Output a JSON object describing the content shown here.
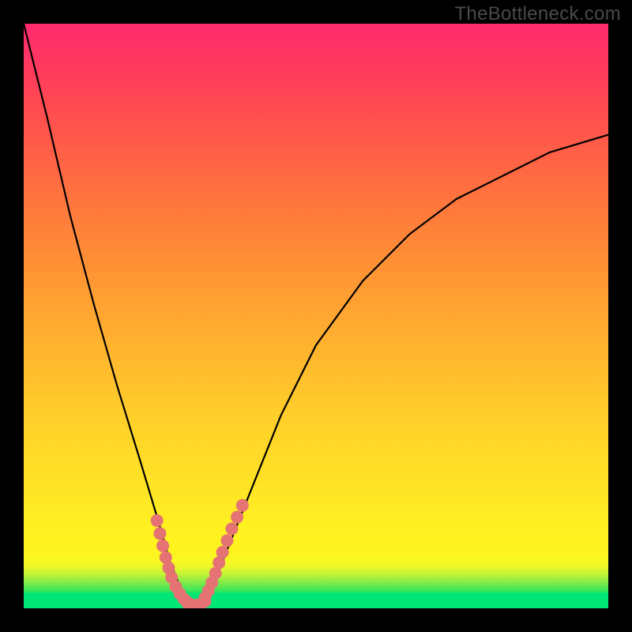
{
  "watermark": "TheBottleneck.com",
  "chart_data": {
    "type": "line",
    "title": "",
    "xlabel": "",
    "ylabel": "",
    "xlim": [
      0,
      100
    ],
    "ylim": [
      0,
      100
    ],
    "series": [
      {
        "name": "curve",
        "color": "#000000",
        "x": [
          0,
          4,
          8,
          12,
          16,
          20,
          23,
          25,
          27,
          28,
          29,
          30,
          32,
          34,
          38,
          44,
          50,
          58,
          66,
          74,
          82,
          90,
          100
        ],
        "y": [
          100,
          84,
          67,
          52,
          38,
          25,
          15,
          8,
          3,
          1,
          0.5,
          1,
          3,
          8,
          18,
          33,
          45,
          56,
          64,
          70,
          74,
          78,
          81
        ]
      },
      {
        "name": "bad-zone-markers",
        "color": "#e57373",
        "markers_only": true,
        "x_left": [
          22.8,
          23.3,
          23.8,
          24.3,
          24.8,
          25.3,
          26.0,
          26.7,
          27.4,
          28.1
        ],
        "y_left": [
          15.0,
          12.8,
          10.7,
          8.7,
          6.9,
          5.3,
          3.7,
          2.5,
          1.6,
          1.0
        ],
        "x_bottom": [
          28.1,
          28.6,
          29.2,
          29.8,
          30.4,
          31.0
        ],
        "y_bottom": [
          0.8,
          0.6,
          0.5,
          0.6,
          0.8,
          1.2
        ],
        "x_right": [
          31.0,
          31.6,
          32.2,
          32.8,
          33.4,
          34.0,
          34.8,
          35.6,
          36.5,
          37.4
        ],
        "y_right": [
          1.8,
          3.0,
          4.4,
          6.0,
          7.8,
          9.6,
          11.6,
          13.6,
          15.6,
          17.6
        ]
      }
    ]
  }
}
